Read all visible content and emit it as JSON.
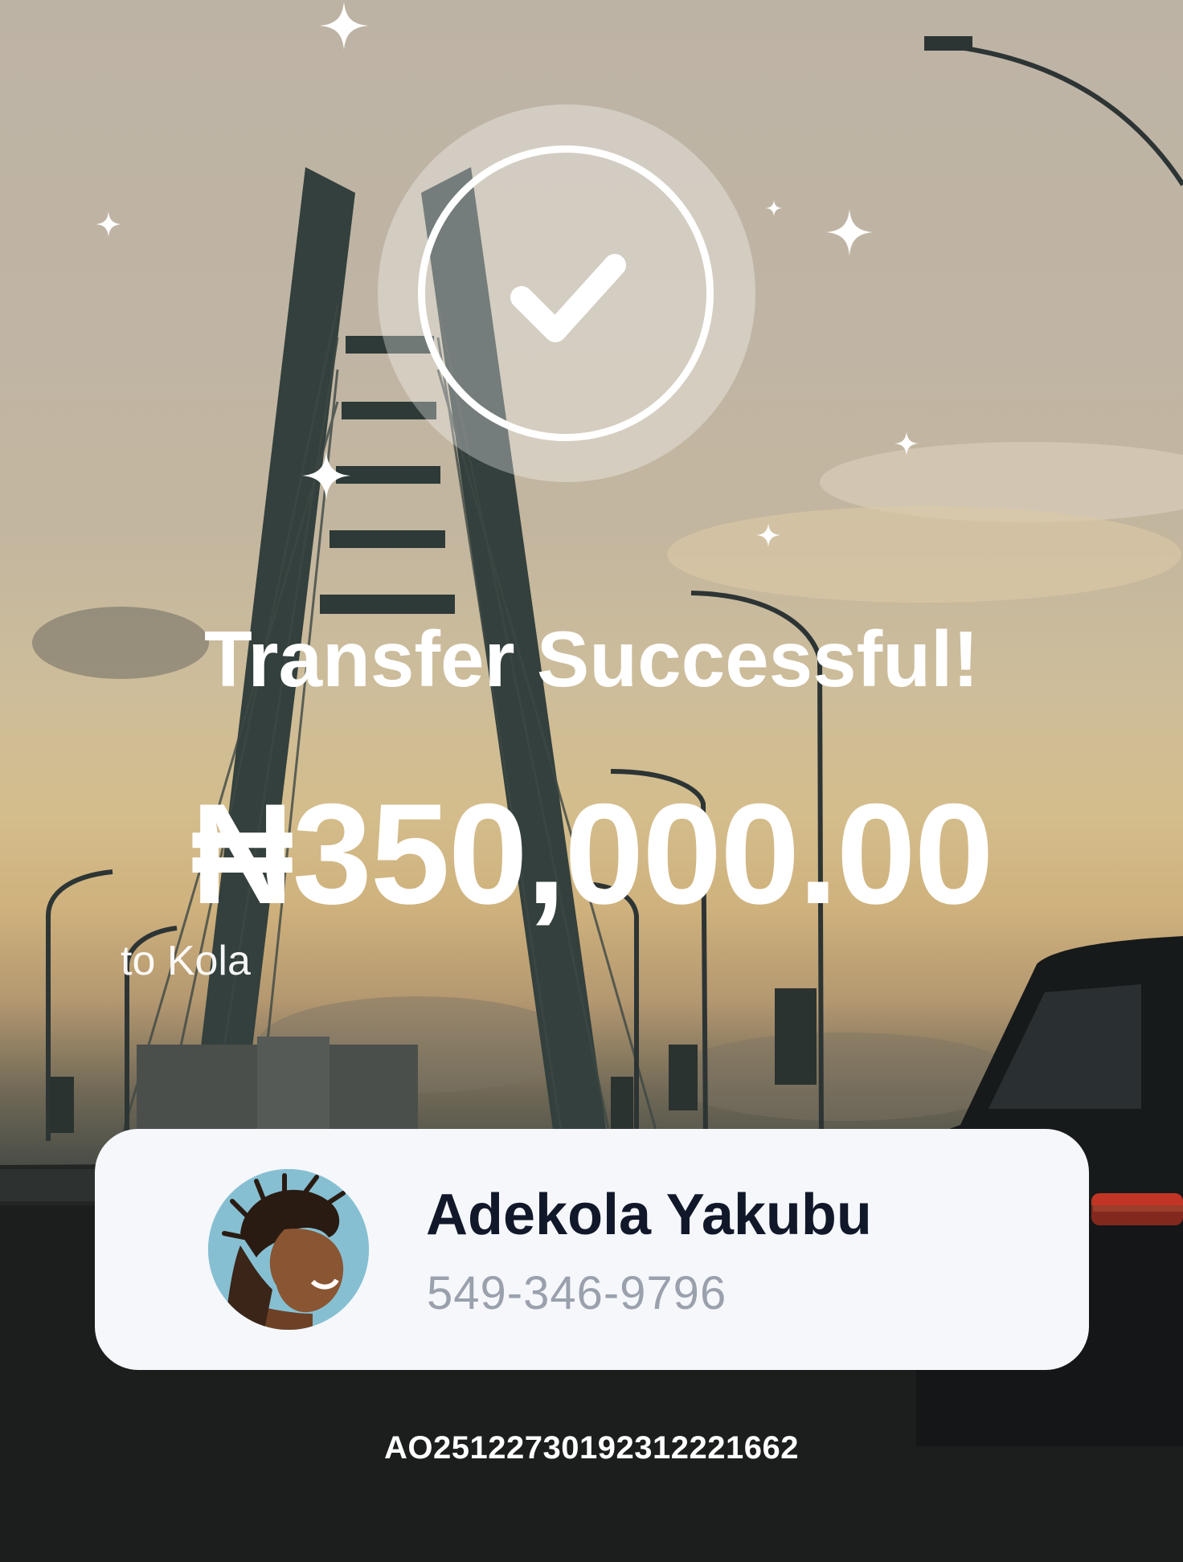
{
  "status": {
    "title": "Transfer Successful!",
    "amount": "₦350,000.00",
    "recipient_short": "to Kola"
  },
  "recipient_card": {
    "name": "Adekola Yakubu",
    "account_number": "549-346-9796"
  },
  "reference": "AO25122730192312221662",
  "colors": {
    "card_background": "#f5f7fb",
    "name_text": "#11182a",
    "account_text": "#9aa1ad",
    "accent_white": "#ffffff"
  },
  "icons": {
    "success": "check-circle-icon",
    "decoration": "sparkle-icon"
  }
}
